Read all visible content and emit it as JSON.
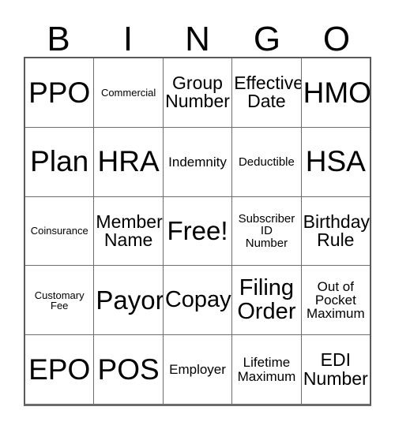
{
  "card": {
    "header_letters": [
      "B",
      "I",
      "N",
      "G",
      "O"
    ],
    "rows": [
      [
        {
          "text": "PPO",
          "size": "fs-xxl"
        },
        {
          "text": "Commercial",
          "size": "fs-xxs"
        },
        {
          "text": "Group\nNumber",
          "size": "fs-md"
        },
        {
          "text": "Effective\nDate",
          "size": "fs-md"
        },
        {
          "text": "HMO",
          "size": "fs-xxl"
        }
      ],
      [
        {
          "text": "Plan",
          "size": "fs-xxl"
        },
        {
          "text": "HRA",
          "size": "fs-xxl"
        },
        {
          "text": "Indemnity",
          "size": "fs-sm"
        },
        {
          "text": "Deductible",
          "size": "fs-xs"
        },
        {
          "text": "HSA",
          "size": "fs-xxl"
        }
      ],
      [
        {
          "text": "Coinsurance",
          "size": "fs-xxs"
        },
        {
          "text": "Member\nName",
          "size": "fs-md"
        },
        {
          "text": "Free!",
          "size": "fs-xl"
        },
        {
          "text": "Subscriber\nID\nNumber",
          "size": "fs-xs"
        },
        {
          "text": "Birthday\nRule",
          "size": "fs-md"
        }
      ],
      [
        {
          "text": "Customary\nFee",
          "size": "fs-xxs"
        },
        {
          "text": "Payor",
          "size": "fs-xl"
        },
        {
          "text": "Copay",
          "size": "fs-lg"
        },
        {
          "text": "Filing\nOrder",
          "size": "fs-lg"
        },
        {
          "text": "Out of\nPocket\nMaximum",
          "size": "fs-sm"
        }
      ],
      [
        {
          "text": "EPO",
          "size": "fs-xxl"
        },
        {
          "text": "POS",
          "size": "fs-xxl"
        },
        {
          "text": "Employer",
          "size": "fs-sm"
        },
        {
          "text": "Lifetime\nMaximum",
          "size": "fs-sm"
        },
        {
          "text": "EDI\nNumber",
          "size": "fs-md"
        }
      ]
    ]
  }
}
